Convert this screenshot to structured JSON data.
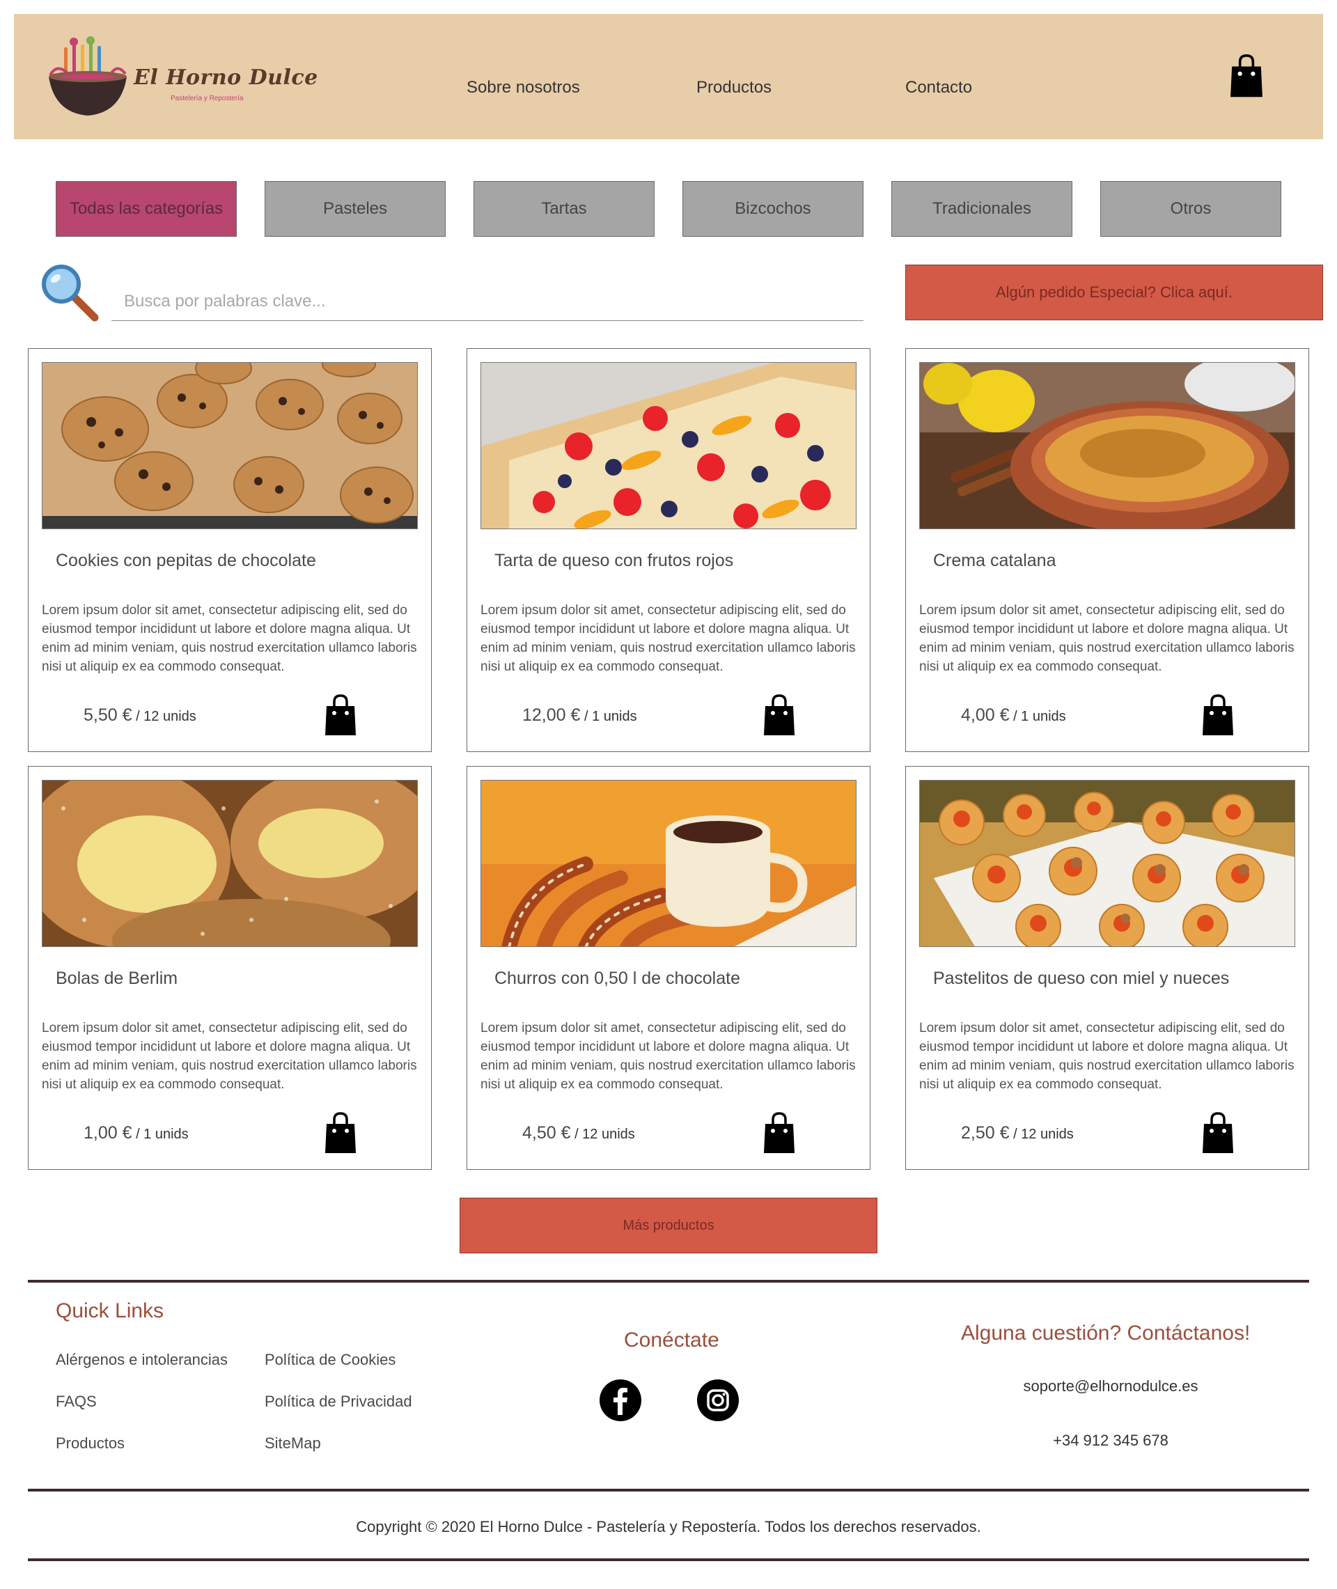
{
  "header": {
    "brand_name": "El Horno Dulce",
    "brand_tagline": "Pastelería y Repostería",
    "nav": [
      "Sobre nosotros",
      "Productos",
      "Contacto"
    ]
  },
  "categories": [
    {
      "label": "Todas las categorías",
      "active": true
    },
    {
      "label": "Pasteles",
      "active": false
    },
    {
      "label": "Tartas",
      "active": false
    },
    {
      "label": "Bizcochos",
      "active": false
    },
    {
      "label": "Tradicionales",
      "active": false
    },
    {
      "label": "Otros",
      "active": false
    }
  ],
  "search": {
    "placeholder": "Busca por palabras clave...",
    "value": ""
  },
  "special_order_label": "Algún pedido Especial? Clica aquí.",
  "products": [
    {
      "name": "Cookies con pepitas de chocolate",
      "description": "Lorem ipsum dolor sit amet, consectetur adipiscing elit, sed do eiusmod tempor incididunt ut labore et dolore magna aliqua. Ut enim ad minim veniam, quis nostrud exercitation ullamco laboris nisi ut aliquip ex ea commodo consequat.",
      "price": "5,50 €",
      "unit": " / 12 unids",
      "image": "cookies-photo"
    },
    {
      "name": "Tarta de queso con frutos rojos",
      "description": "Lorem ipsum dolor sit amet, consectetur adipiscing elit, sed do eiusmod tempor incididunt ut labore et dolore magna aliqua. Ut enim ad minim veniam, quis nostrud exercitation ullamco laboris nisi ut aliquip ex ea commodo consequat.",
      "price": "12,00 €",
      "unit": " / 1 unids",
      "image": "fruit-tart-photo"
    },
    {
      "name": "Crema catalana",
      "description": "Lorem ipsum dolor sit amet, consectetur adipiscing elit, sed do eiusmod tempor incididunt ut labore et dolore magna aliqua. Ut enim ad minim veniam, quis nostrud exercitation ullamco laboris nisi ut aliquip ex ea commodo consequat.",
      "price": "4,00 €",
      "unit": " / 1 unids",
      "image": "crema-catalana-photo"
    },
    {
      "name": "Bolas de Berlim",
      "description": "Lorem ipsum dolor sit amet, consectetur adipiscing elit, sed do eiusmod tempor incididunt ut labore et dolore magna aliqua. Ut enim ad minim veniam, quis nostrud exercitation ullamco laboris nisi ut aliquip ex ea commodo consequat.",
      "price": "1,00 €",
      "unit": " / 1 unids",
      "image": "berliner-photo"
    },
    {
      "name": "Churros con 0,50 l de chocolate",
      "description": "Lorem ipsum dolor sit amet, consectetur adipiscing elit, sed do eiusmod tempor incididunt ut labore et dolore magna aliqua. Ut enim ad minim veniam, quis nostrud exercitation ullamco laboris nisi ut aliquip ex ea commodo consequat.",
      "price": "4,50 €",
      "unit": " / 12 unids",
      "image": "churros-photo"
    },
    {
      "name": "Pastelitos de queso con miel y nueces",
      "description": "Lorem ipsum dolor sit amet, consectetur adipiscing elit, sed do eiusmod tempor incididunt ut labore et dolore magna aliqua. Ut enim ad minim veniam, quis nostrud exercitation ullamco laboris nisi ut aliquip ex ea commodo consequat.",
      "price": "2,50 €",
      "unit": " / 12 unids",
      "image": "pastries-photo"
    }
  ],
  "more_products_label": "Más productos",
  "footer": {
    "quick_links_title": "Quick Links",
    "quick_links": [
      "Alérgenos e intolerancias",
      "Política de Cookies",
      "FAQS",
      "Política de Privacidad",
      "Productos",
      "SiteMap"
    ],
    "connect_title": "Conéctate",
    "social_icons": [
      "facebook-icon",
      "instagram-icon"
    ],
    "contact_title": "Alguna cuestión? Contáctanos!",
    "email": "soporte@elhornodulce.es",
    "phone": "+34 912 345 678",
    "copyright": "Copyright © 2020 El Horno Dulce - Pastelería y Repostería. Todos los derechos reservados."
  },
  "colors": {
    "header_bg": "#e8cda9",
    "active_category": "#b8466f",
    "category_bg": "#a5a5a5",
    "accent_button": "#d35a47",
    "footer_heading": "#9a4f3c"
  }
}
